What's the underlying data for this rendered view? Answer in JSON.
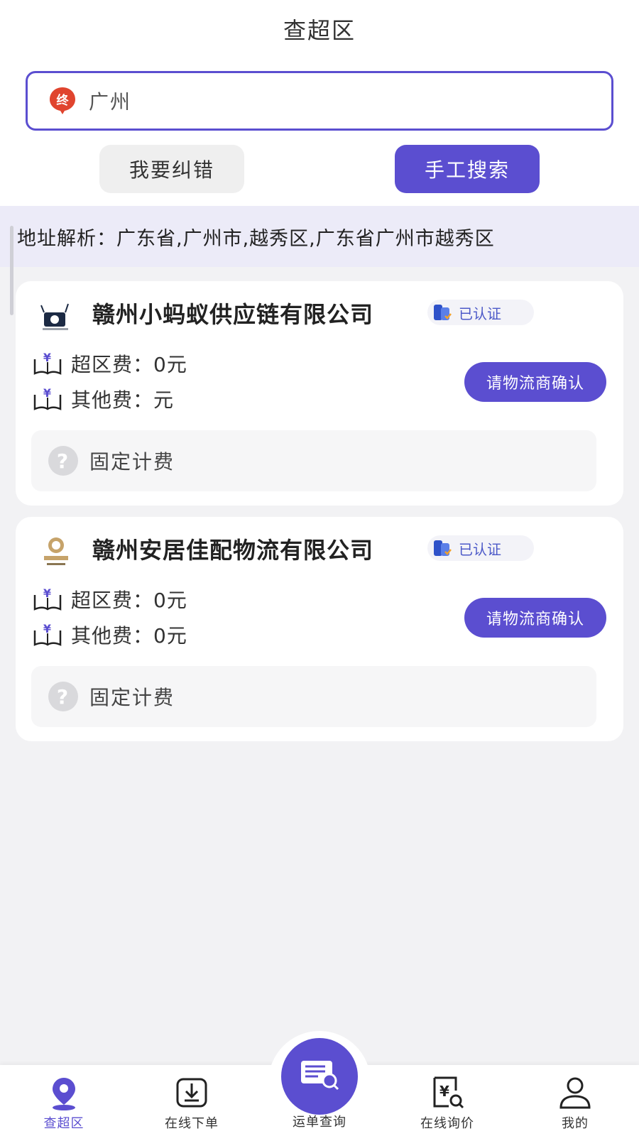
{
  "header": {
    "title": "查超区"
  },
  "search": {
    "value": "广州",
    "icon": "terminal-location-icon"
  },
  "actions": {
    "correct_label": "我要纠错",
    "manual_search_label": "手工搜索"
  },
  "address": {
    "text": "地址解析：广东省,广州市,越秀区,广东省广州市越秀区"
  },
  "results": [
    {
      "company": "赣州小蚂蚁供应链有限公司",
      "verified_label": "已认证",
      "fee_area": "超区费：0元",
      "fee_other": "其他费：元",
      "confirm_label": "请物流商确认",
      "fixed_label": "固定计费"
    },
    {
      "company": "赣州安居佳配物流有限公司",
      "verified_label": "已认证",
      "fee_area": "超区费：0元",
      "fee_other": "其他费：0元",
      "confirm_label": "请物流商确认",
      "fixed_label": "固定计费"
    }
  ],
  "tabbar": {
    "items": [
      {
        "label": "查超区",
        "icon": "location-pin-icon",
        "active": true
      },
      {
        "label": "在线下单",
        "icon": "download-box-icon",
        "active": false
      },
      {
        "label": "运单查询",
        "icon": "waybill-search-icon",
        "active": false
      },
      {
        "label": "在线询价",
        "icon": "price-inquiry-icon",
        "active": false
      },
      {
        "label": "我的",
        "icon": "user-profile-icon",
        "active": false
      }
    ]
  },
  "colors": {
    "accent": "#5b4ed0",
    "verified_text": "#4c59c8",
    "address_bg": "#ecebf8",
    "badge_red": "#e0442e"
  }
}
